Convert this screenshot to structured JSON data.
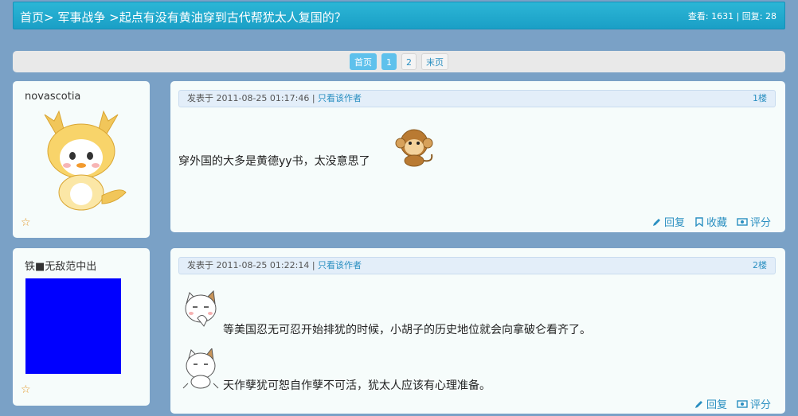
{
  "header": {
    "breadcrumb_home": "首页",
    "breadcrumb_sep1": ">",
    "breadcrumb_category": "军事战争",
    "breadcrumb_sep2": ">",
    "thread_title": "起点有没有黄油穿到古代帮犹太人复国的？",
    "stats": "查看: 1631 | 回复: 28"
  },
  "pager": {
    "first_label": "首页",
    "pages": [
      "1",
      "2"
    ],
    "current_page": "1",
    "last_label": "末页"
  },
  "posts": [
    {
      "username": "novascotia",
      "avatar": "yellow-dragon-mascot-image",
      "meta_prefix": "发表于 2011-08-25 01:17:46 |",
      "meta_link": "只看该作者",
      "floor": "1楼",
      "lines": [
        "穿外国的大多是黄德yy书，太没意思了"
      ],
      "emoticons": [
        "monkey-emoticon"
      ],
      "actions": [
        "回复",
        "收藏",
        "评分"
      ]
    },
    {
      "username": "铁■无敌范中出",
      "avatar": "blue-square-avatar",
      "avatar_color": "#0000ff",
      "meta_prefix": "发表于 2011-08-25 01:22:14 |",
      "meta_link": "只看该作者",
      "floor": "2楼",
      "lines": [
        "等美国忍无可忍开始排犹的时候，小胡子的历史地位就会向拿破仑看齐了。",
        "天作孽犹可恕自作孽不可活，犹太人应该有心理准备。"
      ],
      "emoticons": [
        "cat-thinking-emoticon",
        "cat-waving-emoticon"
      ],
      "actions": [
        "回复",
        "评分"
      ]
    }
  ],
  "colors": {
    "page_bg": "#7aa1c6",
    "header_bg": "#1fa8cf",
    "link": "#2a8fc1",
    "star": "#e39a2e"
  }
}
